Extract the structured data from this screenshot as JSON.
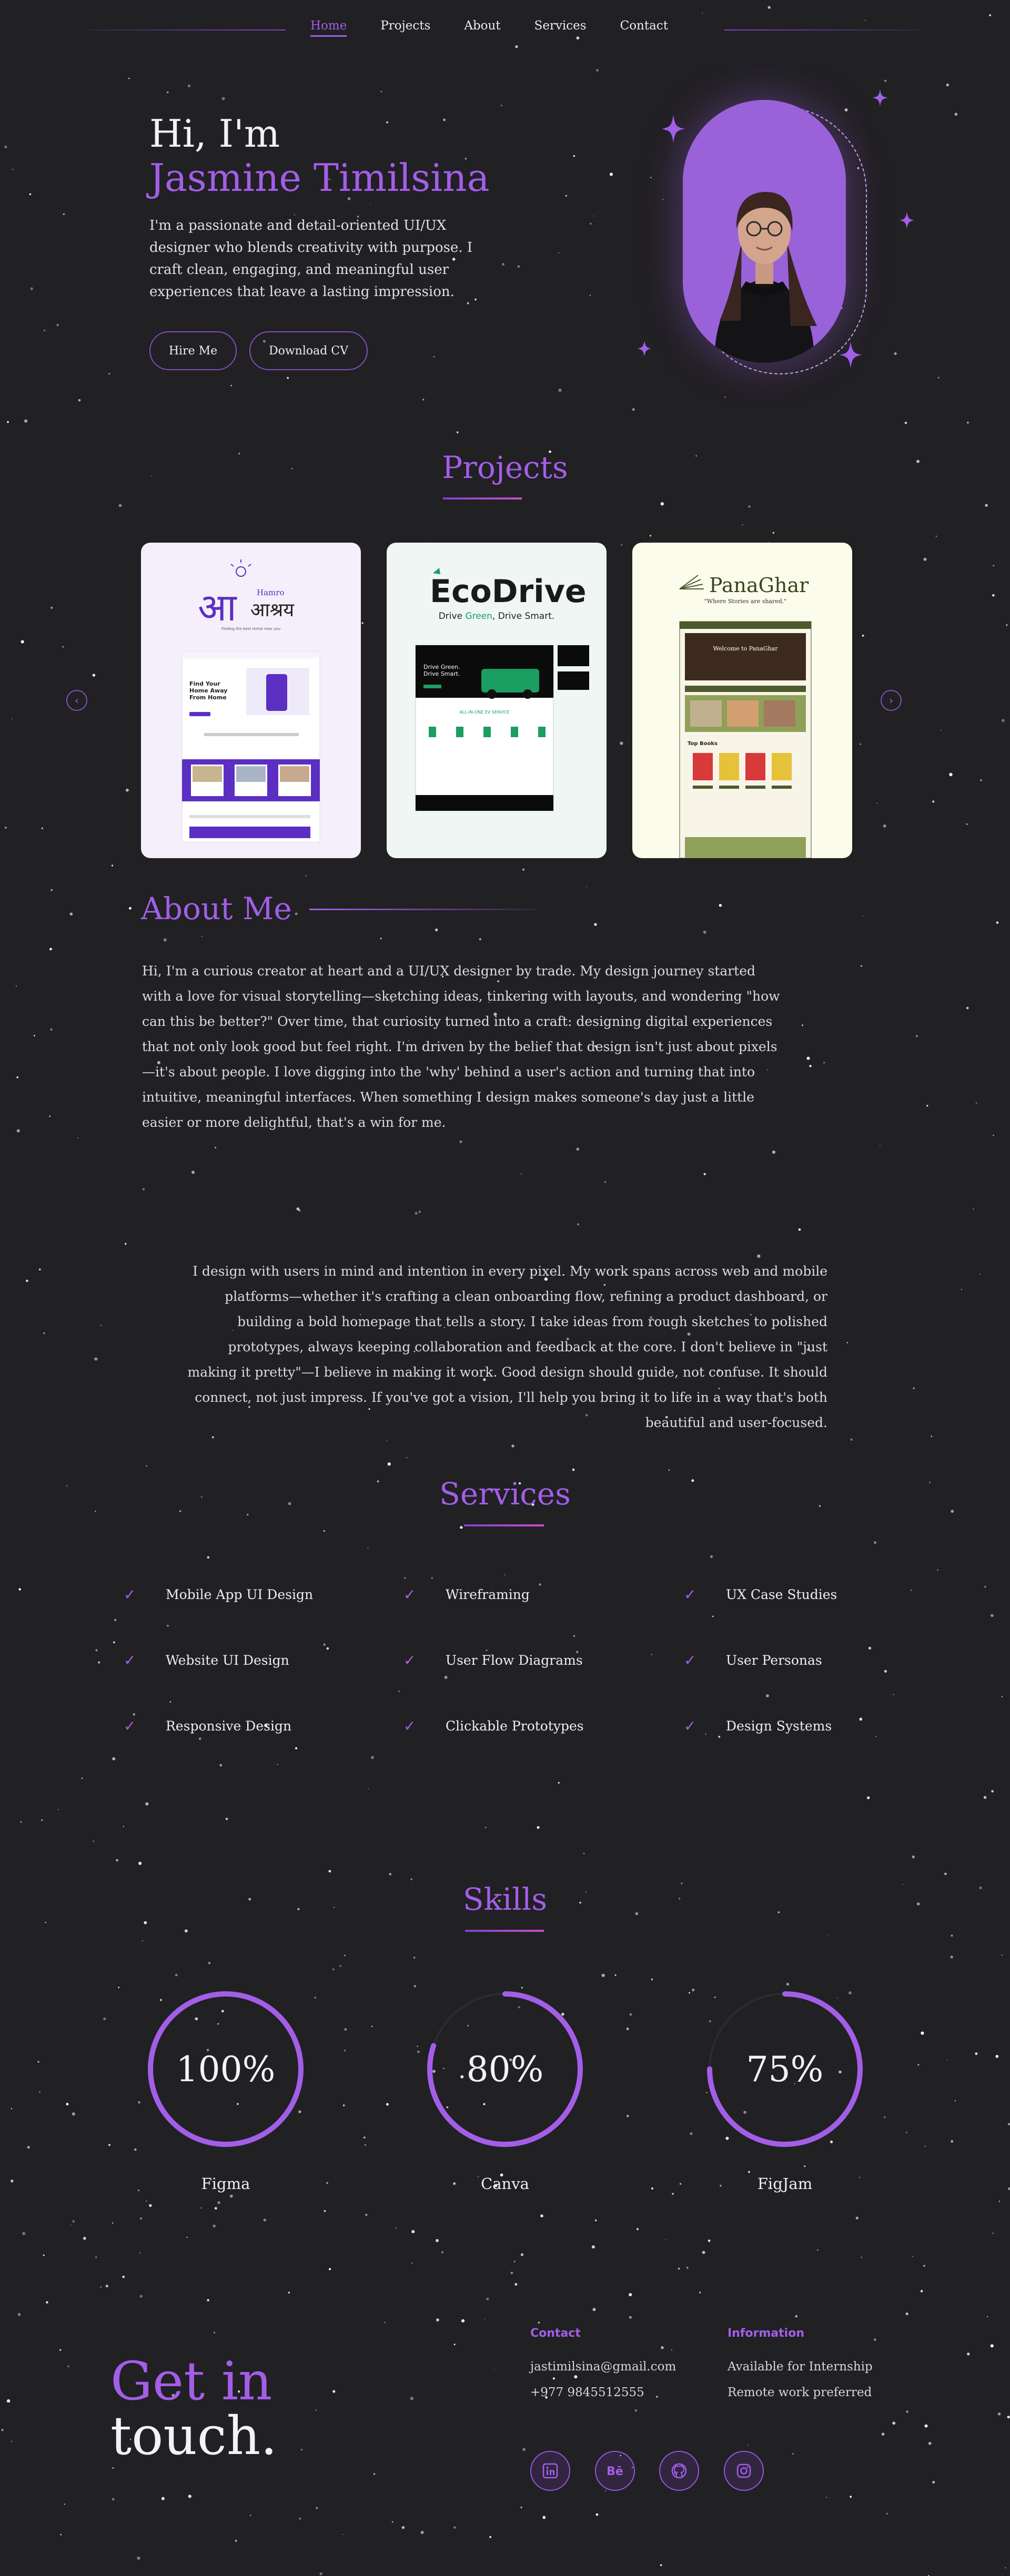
{
  "nav": {
    "links": [
      {
        "label": "Home",
        "active": true
      },
      {
        "label": "Projects",
        "active": false
      },
      {
        "label": "About",
        "active": false
      },
      {
        "label": "Services",
        "active": false
      },
      {
        "label": "Contact",
        "active": false
      }
    ]
  },
  "hero": {
    "greeting": "Hi, I'm",
    "name": "Jasmine Timilsina",
    "description": "I'm a passionate and detail-oriented UI/UX designer who blends creativity with purpose. I craft clean, engaging, and meaningful user experiences that leave a lasting impression.",
    "hire_button": "Hire Me",
    "cv_button": "Download CV"
  },
  "projects": {
    "title": "Projects",
    "cards": [
      {
        "brand_script": "आ",
        "brand_small": "Hamro",
        "brand_main": "आश्रय",
        "tagline": "Finding the best rental near you",
        "mock_heading": "Find Your Home Away From Home"
      },
      {
        "brand_main": "EcoDrive",
        "tagline_prefix": "Drive ",
        "tagline_green": "Green",
        "tagline_suffix": ", Drive Smart.",
        "mock_heading": "Drive Green. Drive Smart."
      },
      {
        "brand_main": "PanaGhar",
        "tagline": "\"Where Stories are shared.\"",
        "mock_heading": "Welcome to PanaGhar"
      }
    ]
  },
  "about": {
    "title": "About Me",
    "paragraph1": "Hi, I'm a curious creator at heart and a UI/UX designer by trade. My design journey started with a love for visual storytelling—sketching ideas, tinkering with layouts, and wondering \"how can this be better?\" Over time, that curiosity turned into a craft: designing digital experiences that not only look good but feel right. I'm driven by the belief that design isn't just about pixels—it's about people. I love digging into the 'why' behind a user's action and turning that into intuitive, meaningful interfaces. When something I design makes someone's day just a little easier or more delightful, that's a win for me.",
    "paragraph2": "I design with users in mind and intention in every pixel. My work spans across web and mobile platforms—whether it's crafting a clean onboarding flow, refining a product dashboard, or building a bold homepage that tells a story. I take ideas from rough sketches to polished prototypes, always keeping collaboration and feedback at the core. I don't believe in \"just making it pretty\"—I believe in making it work. Good design should guide, not confuse. It should connect, not just impress. If you've got a vision, I'll help you bring it to life in a way that's both beautiful and user-focused."
  },
  "services": {
    "title": "Services",
    "items": [
      "Mobile App UI Design",
      "Wireframing",
      "UX Case Studies",
      "Website UI Design",
      "User Flow Diagrams",
      "User Personas",
      "Responsive Design",
      "Clickable Prototypes",
      "Design Systems"
    ]
  },
  "skills": {
    "title": "Skills",
    "items": [
      {
        "name": "Figma",
        "percent_label": "100%",
        "value": 100
      },
      {
        "name": "Canva",
        "percent_label": "80%",
        "value": 80
      },
      {
        "name": "FigJam",
        "percent_label": "75%",
        "value": 75
      }
    ]
  },
  "contact": {
    "heading_line1": "Get in",
    "heading_line2": "touch.",
    "contact_title": "Contact",
    "email": "jastimilsina@gmail.com",
    "phone": "+977 9845512555",
    "info_title": "Information",
    "info1": "Available for Internship",
    "info2": "Remote work preferred",
    "socials": [
      "linkedin-icon",
      "behance-icon",
      "github-icon",
      "instagram-icon"
    ]
  },
  "colors": {
    "background": "#212023",
    "accent": "#a35ee8",
    "eco_green": "#1a9e62",
    "panaghar_olive": "#4d5a2b"
  }
}
